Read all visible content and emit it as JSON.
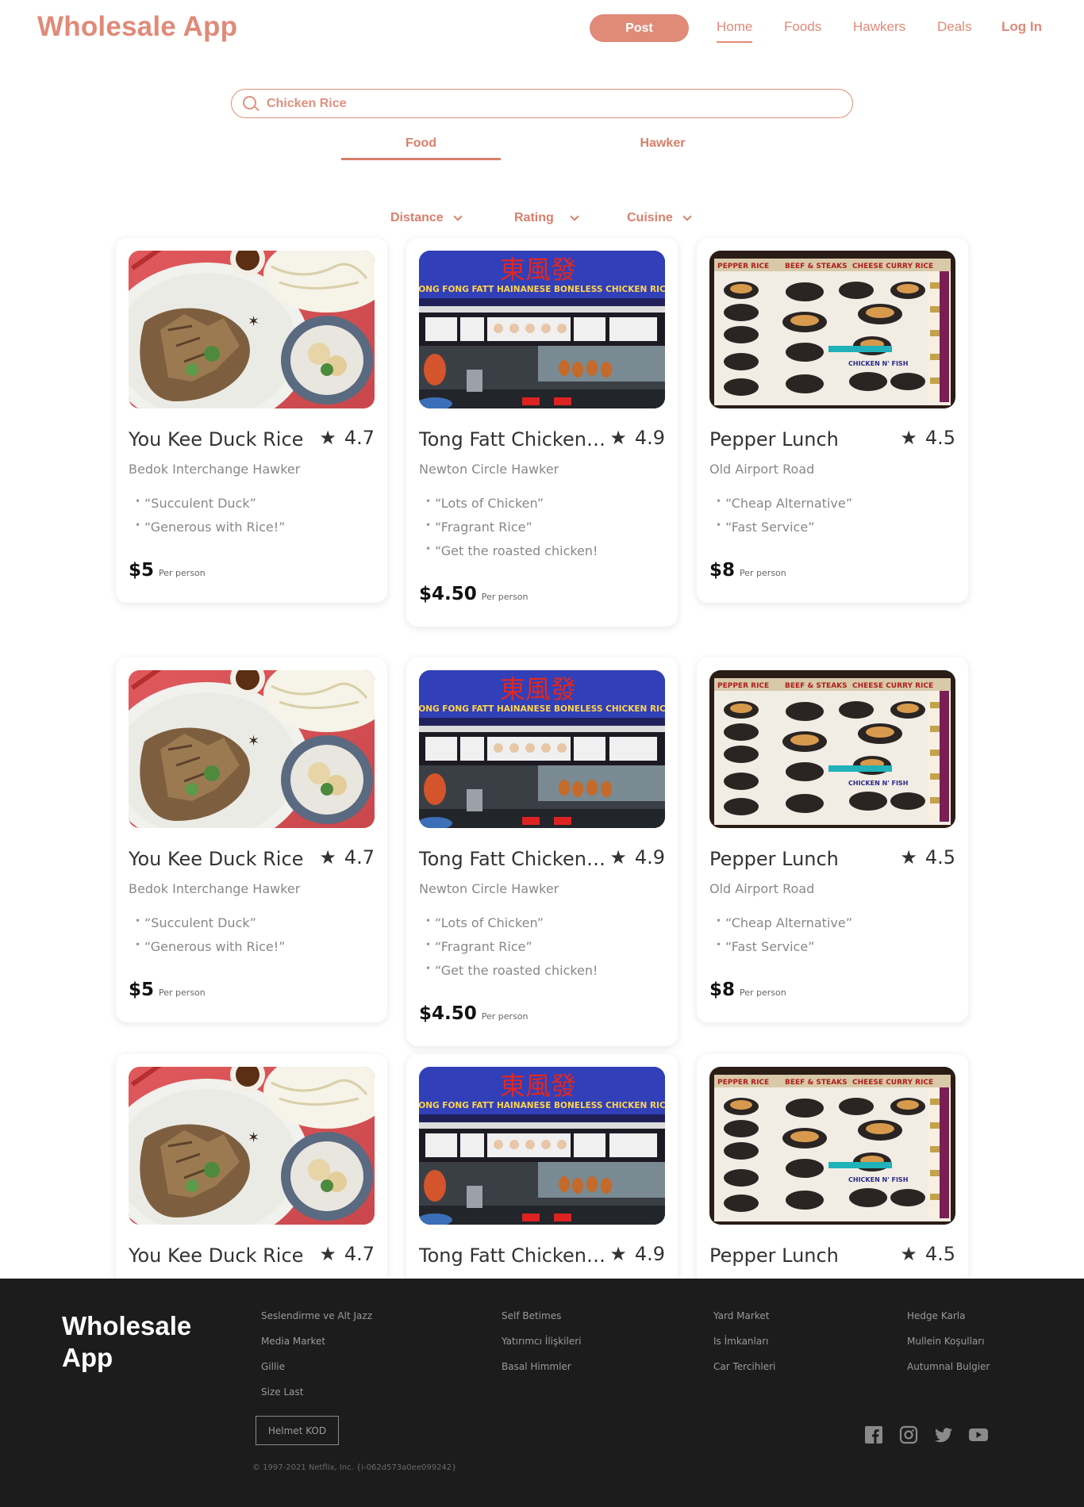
{
  "header": {
    "brand": "Wholesale App",
    "post_label": "Post",
    "nav": {
      "home": "Home",
      "foods": "Foods",
      "hawkers": "Hawkers",
      "deals": "Deals",
      "login": "Log In"
    }
  },
  "search": {
    "value": "Chicken Rice"
  },
  "tabs": {
    "food": "Food",
    "hawker": "Hawker"
  },
  "filters": {
    "distance": "Distance",
    "rating": "Rating",
    "cuisine": "Cuisine"
  },
  "cards": [
    {
      "name": "You Kee Duck Rice",
      "rating": "4.7",
      "location": "Bedok Interchange Hawker",
      "reviews": [
        "“Succulent Duck”",
        "“Generous with Rice!”"
      ],
      "price": "$5",
      "per": "Per person"
    },
    {
      "name": "Tong Fatt Chicken Rice",
      "rating": "4.9",
      "location": "Newton Circle Hawker",
      "reviews": [
        "“Lots of Chicken”",
        "“Fragrant Rice”",
        "“Get the roasted chicken!"
      ],
      "price": "$4.50",
      "per": "Per person"
    },
    {
      "name": "Pepper Lunch",
      "rating": "4.5",
      "location": "Old Airport Road",
      "reviews": [
        "“Cheap Alternative”",
        "“Fast Service”"
      ],
      "price": "$8",
      "per": "Per person"
    },
    {
      "name": "You Kee Duck Rice",
      "rating": "4.7",
      "location": "Bedok Interchange Hawker",
      "reviews": [
        "“Succulent Duck”",
        "“Generous with Rice!”"
      ],
      "price": "$5",
      "per": "Per person"
    },
    {
      "name": "Tong Fatt Chicken Rice",
      "rating": "4.9",
      "location": "Newton Circle Hawker",
      "reviews": [
        "“Lots of Chicken”",
        "“Fragrant Rice”",
        "“Get the roasted chicken!"
      ],
      "price": "$4.50",
      "per": "Per person"
    },
    {
      "name": "Pepper Lunch",
      "rating": "4.5",
      "location": "Old Airport Road",
      "reviews": [
        "“Cheap Alternative”",
        "“Fast Service”"
      ],
      "price": "$8",
      "per": "Per person"
    },
    {
      "name": "You Kee Duck Rice",
      "rating": "4.7"
    },
    {
      "name": "Tong Fatt Chicken Rice",
      "rating": "4.9"
    },
    {
      "name": "Pepper Lunch",
      "rating": "4.5"
    }
  ],
  "stall_sign": {
    "chinese": "東風發",
    "english": "TONG FONG FATT HAINANESE BONELESS CHICKEN RICE"
  },
  "menu_board": {
    "labels": [
      "PEPPER RICE",
      "BEEF & STEAKS",
      "CHEESE CURRY RICE",
      "CHICKEN N' FISH"
    ]
  },
  "footer": {
    "brand": "Wholesale App",
    "col1": [
      "Seslendirme ve Alt Jazz",
      "Media Market",
      "Gillie",
      "Size Last"
    ],
    "col2": [
      "Self Betimes",
      "Yatırımcı İlişkileri",
      "Basal Himmler"
    ],
    "col3": [
      "Yard Market",
      "Is İmkanları",
      "Car Tercihleri"
    ],
    "col4": [
      "Hedge Karla",
      "Mullein Koşulları",
      "Autumnal Bulgier"
    ],
    "button": "Helmet KOD",
    "copyright": "© 1997-2021 Netflix, Inc.  {i-062d573a0ee099242}"
  },
  "colors": {
    "accent": "#e08a78",
    "footer_bg": "#1c1c1c"
  }
}
